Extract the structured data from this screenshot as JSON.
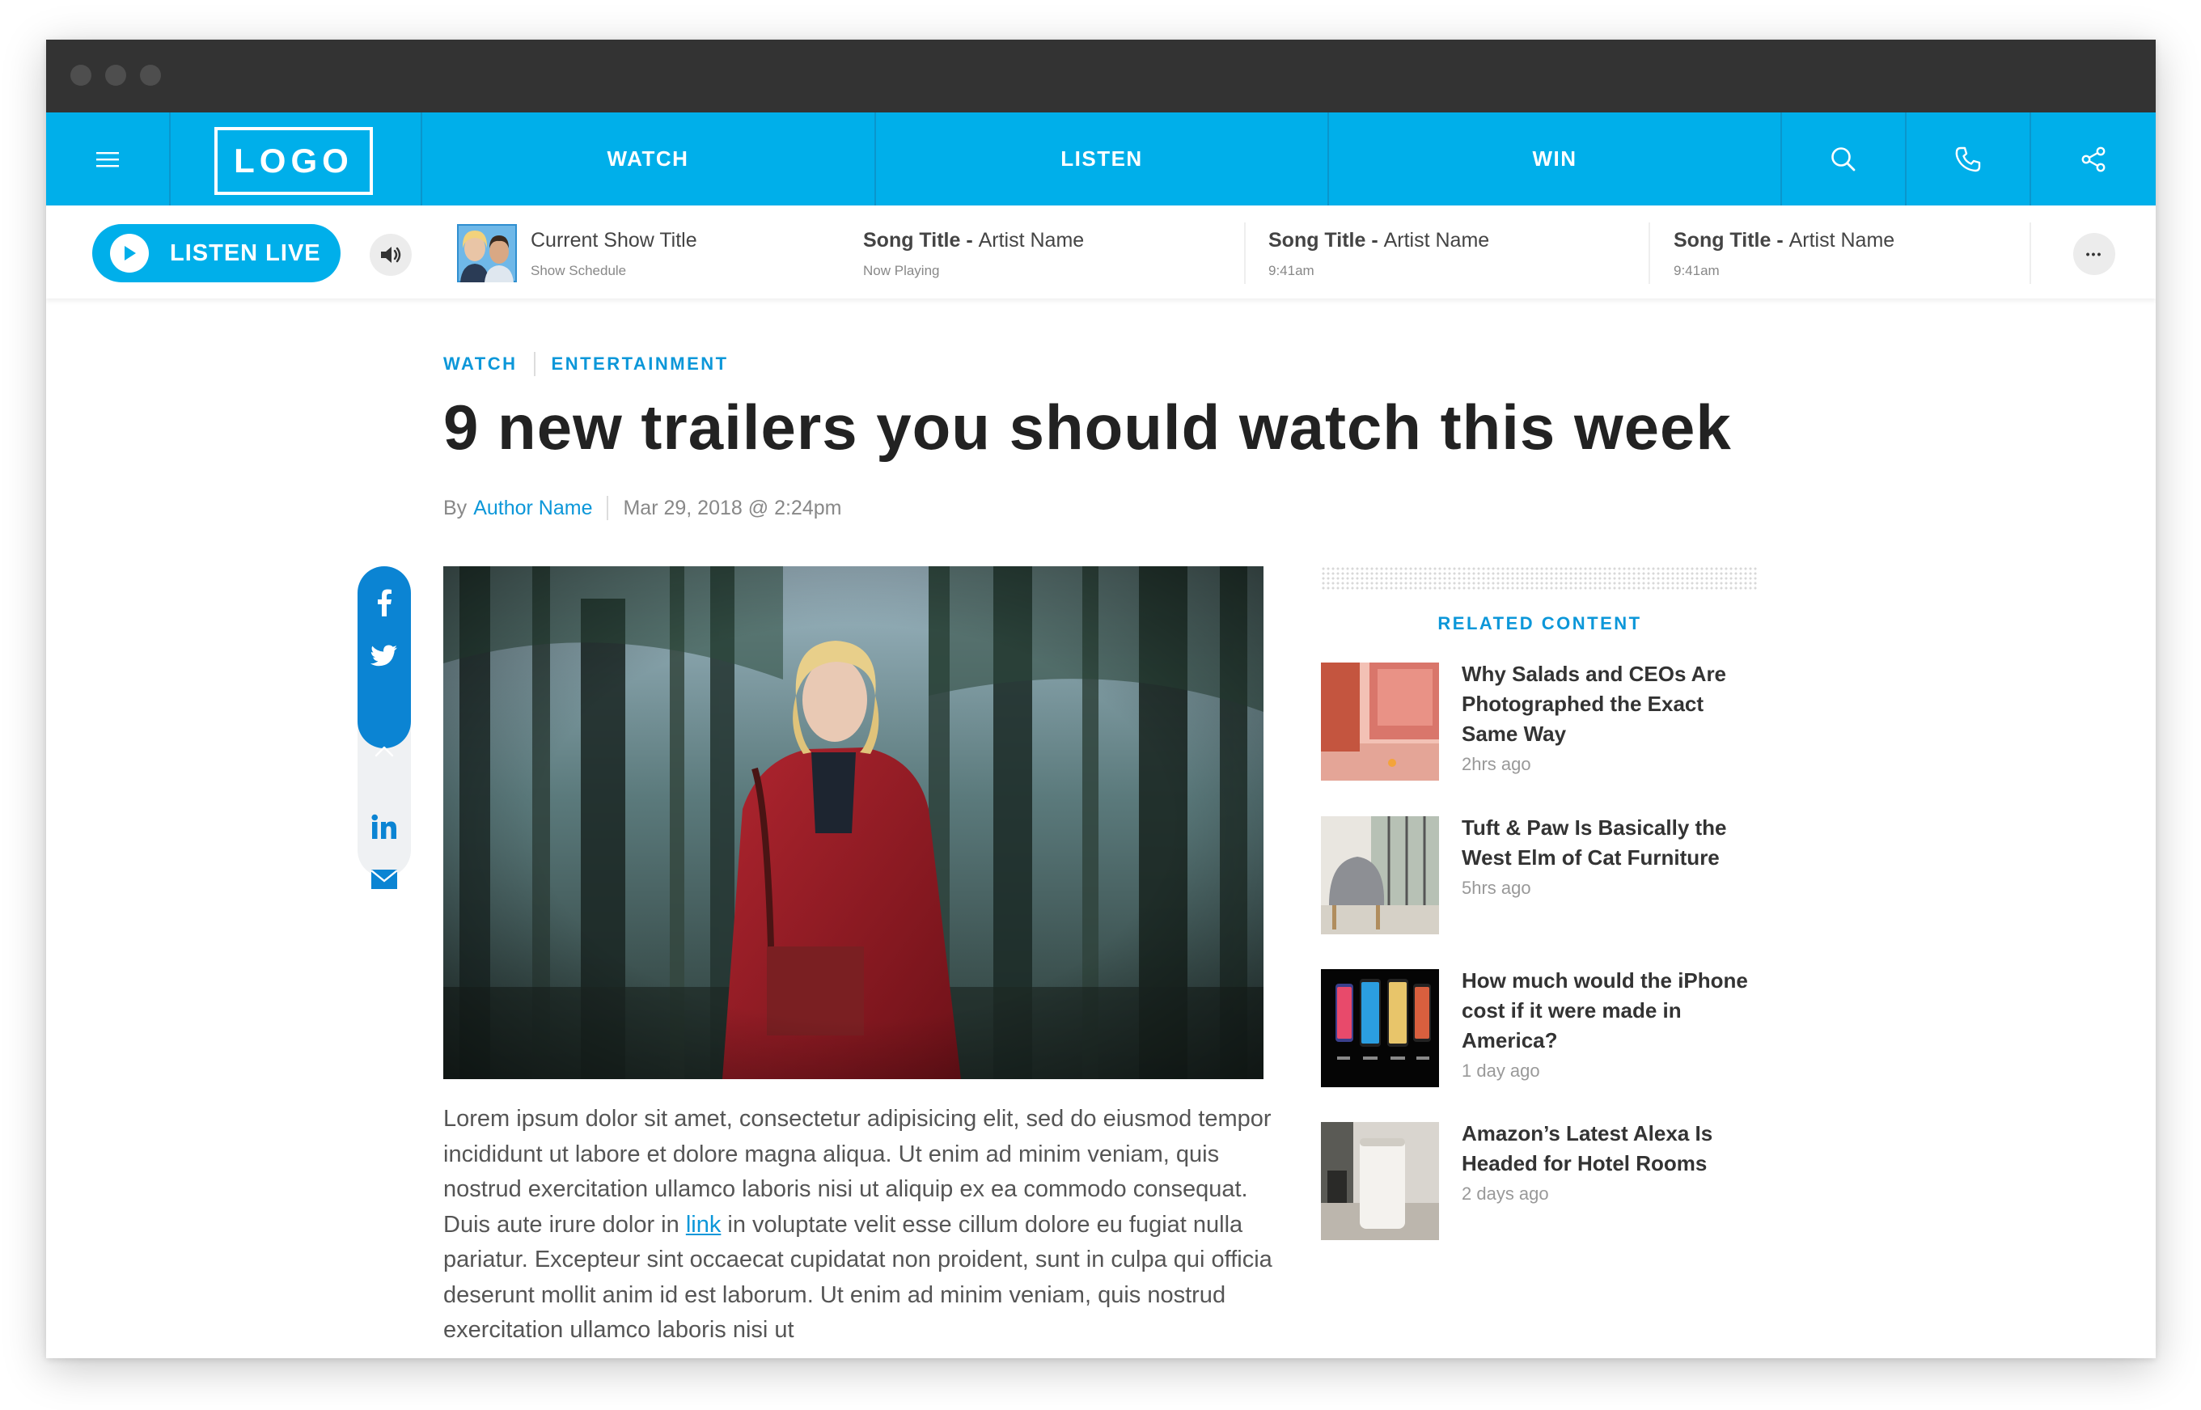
{
  "nav": {
    "logo": "LOGO",
    "links": [
      "WATCH",
      "LISTEN",
      "WIN"
    ]
  },
  "player": {
    "listen_live": "LISTEN LIVE",
    "show": {
      "title": "Current Show Title",
      "subtitle": "Show Schedule"
    },
    "tracks": [
      {
        "song": "Song Title",
        "artist": "Artist Name",
        "status": "Now Playing"
      },
      {
        "song": "Song Title",
        "artist": "Artist Name",
        "status": "9:41am"
      },
      {
        "song": "Song Title",
        "artist": "Artist Name",
        "status": "9:41am"
      }
    ],
    "more": "•••"
  },
  "article": {
    "breadcrumbs": [
      "WATCH",
      "ENTERTAINMENT"
    ],
    "headline": "9 new trailers you should watch this week",
    "by": "By",
    "author": "Author Name",
    "date": "Mar 29, 2018 @ 2:24pm",
    "body_before_link": "Lorem ipsum dolor sit amet, consectetur adipisicing elit, sed do eiusmod tempor incididunt ut labore et dolore magna aliqua. Ut enim ad minim veniam, quis nostrud exercitation ullamco laboris nisi ut aliquip ex ea commodo consequat. Duis aute irure dolor in ",
    "body_link": "link",
    "body_after_link": " in voluptate velit esse cillum dolore eu fugiat nulla pariatur. Excepteur sint occaecat cupidatat non proident, sunt in culpa qui officia deserunt mollit anim id est laborum. Ut enim ad minim veniam, quis nostrud exercitation ullamco laboris nisi ut"
  },
  "share": {
    "icons": [
      "facebook-icon",
      "twitter-icon",
      "chevron-up-icon",
      "linkedin-icon",
      "mail-icon"
    ]
  },
  "related": {
    "title": "RELATED CONTENT",
    "items": [
      {
        "title": "Why Salads and CEOs Are Photographed the Exact Same Way",
        "time": "2hrs ago"
      },
      {
        "title": "Tuft & Paw Is Basically the West Elm of Cat Furniture",
        "time": "5hrs ago"
      },
      {
        "title": "How much would the iPhone cost if it were made in America?",
        "time": "1 day ago"
      },
      {
        "title": "Amazon’s Latest Alexa Is Headed for Hotel Rooms",
        "time": "2 days ago"
      }
    ]
  },
  "colors": {
    "brand": "#00afea",
    "link": "#0c97d9",
    "share_active": "#0b84d3",
    "titlebar": "#333333"
  }
}
